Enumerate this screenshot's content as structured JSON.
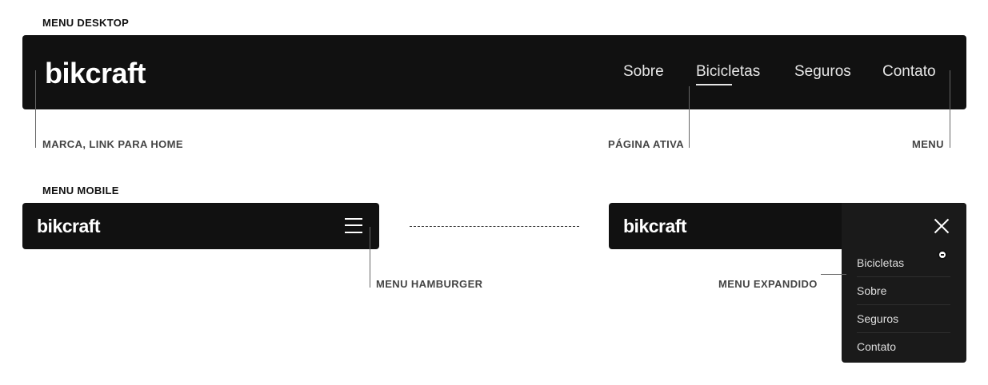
{
  "sections": {
    "desktop_title": "MENU DESKTOP",
    "mobile_title": "MENU MOBILE"
  },
  "desktop": {
    "brand": "bikcraft",
    "nav": [
      {
        "label": "Sobre"
      },
      {
        "label": "Bicicletas",
        "active": true
      },
      {
        "label": "Seguros"
      },
      {
        "label": "Contato"
      }
    ]
  },
  "annotations": {
    "brand": "MARCA, LINK PARA HOME",
    "active_page": "PÁGINA ATIVA",
    "menu": "MENU",
    "hamburger": "MENU HAMBURGER",
    "expanded": "MENU EXPANDIDO"
  },
  "mobile": {
    "brand": "bikcraft",
    "hamburger_icon": "hamburger-menu-icon"
  },
  "mobile_expanded": {
    "brand": "bikcraft",
    "close_icon": "close-icon",
    "items": [
      {
        "label": "Bicicletas"
      },
      {
        "label": "Sobre"
      },
      {
        "label": "Seguros"
      },
      {
        "label": "Contato"
      }
    ]
  },
  "colors": {
    "bar": "#111111",
    "dropdown": "#1a1a1a",
    "text_light": "#ffffff",
    "annotation": "#444444"
  }
}
